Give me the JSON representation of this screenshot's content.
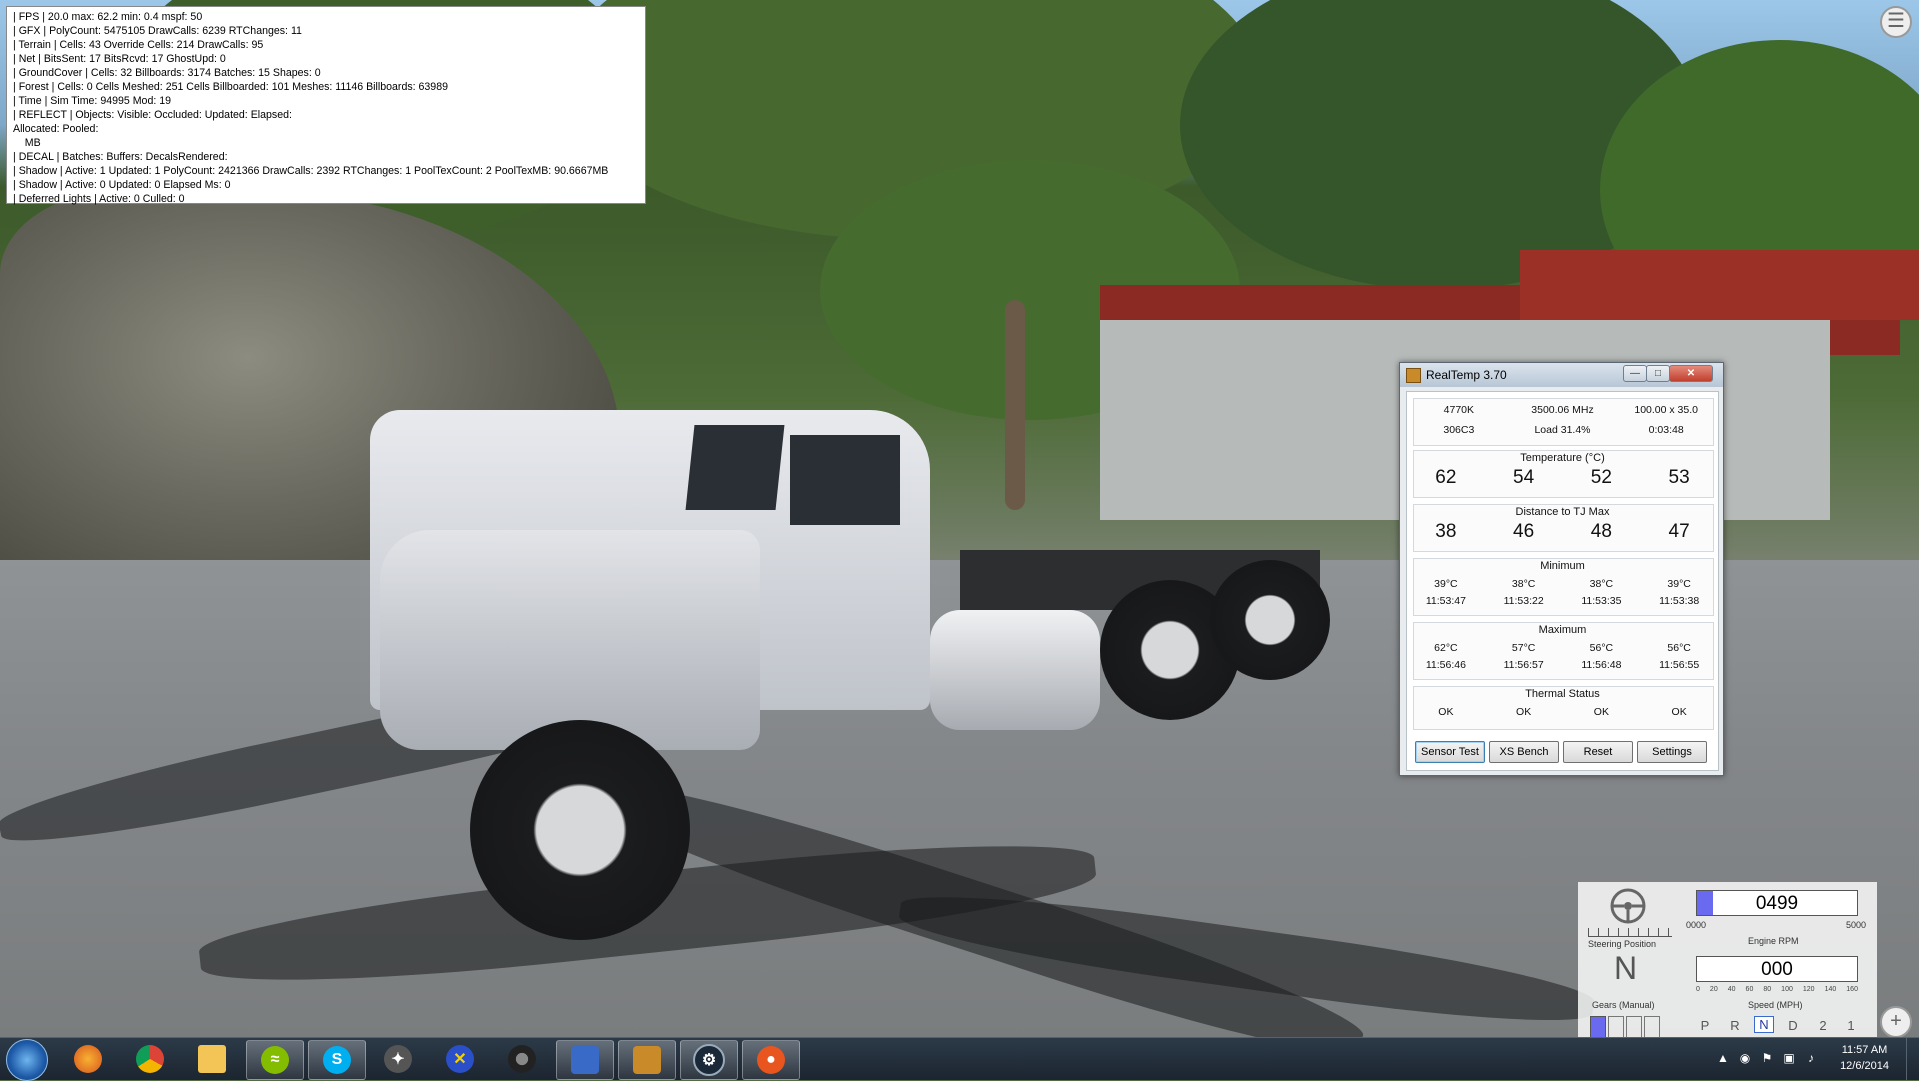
{
  "debug_lines": [
    "| FPS |  20.0  max: 62.2  min:  0.4  mspf: 50",
    "| GFX |  PolyCount: 5475105  DrawCalls: 6239  RTChanges: 11",
    "| Terrain |  Cells: 43  Override Cells: 214  DrawCalls: 95",
    "| Net |  BitsSent: 17  BitsRcvd: 17  GhostUpd: 0",
    "| GroundCover |  Cells: 32  Billboards: 3174  Batches: 15  Shapes: 0",
    "| Forest |  Cells: 0  Cells Meshed: 251  Cells Billboarded: 101  Meshes: 11146  Billboards: 63989",
    "| Time |  Sim Time: 94995  Mod: 19",
    "| REFLECT |  Objects:   Visible:   Occluded:   Updated:   Elapsed:",
    "Allocated:   Pooled:",
    "    MB",
    "| DECAL | Batches:  Buffers:  DecalsRendered:",
    "| Shadow |  Active: 1  Updated: 1  PolyCount: 2421366  DrawCalls: 2392  RTChanges: 1   PoolTexCount: 2   PoolTexMB: 90.6667MB",
    "| Shadow |  Active: 0  Updated: 0  Elapsed Ms: 0",
    "| Deferred Lights |  Active: 0  Culled: 0"
  ],
  "realtemp": {
    "title": "RealTemp 3.70",
    "window_buttons": {
      "minimize": "—",
      "maximize": "□",
      "close": "✕"
    },
    "info": {
      "cpu": "4770K",
      "freq": "3500.06 MHz",
      "multiplier": "100.00 x 35.0",
      "stepping": "306C3",
      "load": "Load  31.4%",
      "uptime": "0:03:48"
    },
    "temperature": {
      "title": "Temperature (°C)",
      "values": [
        "62",
        "54",
        "52",
        "53"
      ]
    },
    "distance": {
      "title": "Distance to TJ Max",
      "values": [
        "38",
        "46",
        "48",
        "47"
      ]
    },
    "minimum": {
      "title": "Minimum",
      "temps": [
        "39°C",
        "38°C",
        "38°C",
        "39°C"
      ],
      "times": [
        "11:53:47",
        "11:53:22",
        "11:53:35",
        "11:53:38"
      ]
    },
    "maximum": {
      "title": "Maximum",
      "temps": [
        "62°C",
        "57°C",
        "56°C",
        "56°C"
      ],
      "times": [
        "11:56:46",
        "11:56:57",
        "11:56:48",
        "11:56:55"
      ]
    },
    "thermal": {
      "title": "Thermal Status",
      "values": [
        "OK",
        "OK",
        "OK",
        "OK"
      ]
    },
    "buttons": {
      "sensor_test": "Sensor Test",
      "xs_bench": "XS Bench",
      "reset": "Reset",
      "settings": "Settings"
    }
  },
  "hud": {
    "steering_label": "Steering Position",
    "rpm_value": "0499",
    "rpm_min": "0000",
    "rpm_max": "5000",
    "rpm_label": "Engine RPM",
    "rpm_fraction": 0.1,
    "gear_current": "N",
    "speed_value": "000",
    "speed_scale": [
      "0",
      "20",
      "40",
      "60",
      "80",
      "100",
      "120",
      "140",
      "160"
    ],
    "gears_label": "Gears (Manual)",
    "speed_label": "Speed (MPH)",
    "gear_letters": [
      "P",
      "R",
      "N",
      "D",
      "2",
      "1"
    ],
    "selected_gear": "N"
  },
  "taskbar": {
    "apps": [
      "Start",
      "Firefox",
      "Chrome",
      "Windows Explorer",
      "Spotify",
      "Skype",
      "Game",
      "XSplit",
      "Tire App",
      "BeamNG",
      "RealTemp",
      "Steam",
      "App"
    ],
    "clock_time": "11:57 AM",
    "clock_date": "12/6/2014"
  },
  "colors": {
    "taskbar_bg": "#1c2530",
    "rpm_fill": "#6a6af0",
    "roof_red": "#8a2a22"
  }
}
